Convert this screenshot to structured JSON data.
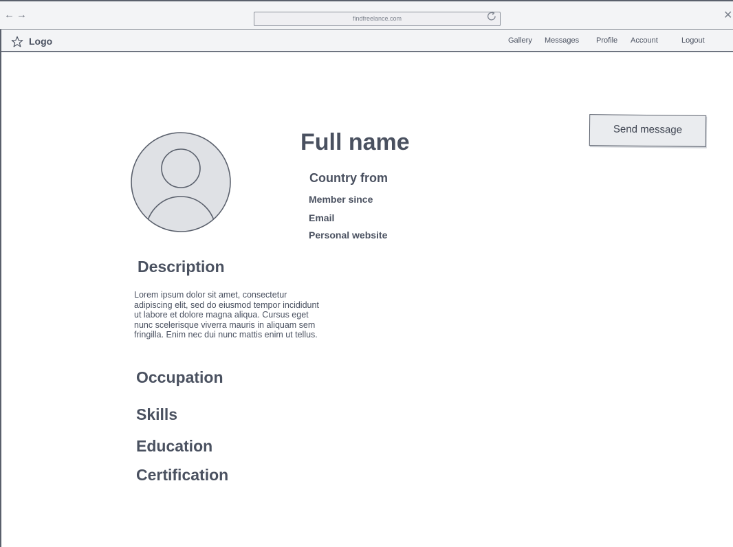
{
  "browser": {
    "url": "findfreelance.com",
    "back_icon": "arrow-left-icon",
    "forward_icon": "arrow-right-icon",
    "reload_icon": "reload-icon",
    "close_icon": "close-icon",
    "back_glyph": "←",
    "forward_glyph": "→",
    "close_glyph": "✕"
  },
  "header": {
    "logo_icon": "star-icon",
    "logo_label": "Logo",
    "nav": {
      "gallery": "Gallery",
      "messages": "Messages",
      "profile": "Profile",
      "account": "Account",
      "logout": "Logout"
    }
  },
  "profile": {
    "avatar_icon": "user-avatar-icon",
    "full_name": "Full name",
    "country": "Country from",
    "member_since": "Member since",
    "email": "Email",
    "website": "Personal website",
    "send_message_label": "Send message"
  },
  "sections": {
    "description_heading": "Description",
    "description_text": "Lorem ipsum dolor sit amet, consectetur\nadipiscing elit, sed do eiusmod tempor incididunt\nut labore et dolore magna aliqua. Cursus eget\nnunc scelerisque viverra mauris in aliquam sem\nfringilla. Enim nec dui nunc mattis enim ut tellus.",
    "occupation_heading": "Occupation",
    "skills_heading": "Skills",
    "education_heading": "Education",
    "certification_heading": "Certification"
  },
  "colors": {
    "text": "#4a5160",
    "chrome_bg": "#f3f4f6",
    "border": "#5a606c",
    "button_bg": "#eaecef"
  }
}
